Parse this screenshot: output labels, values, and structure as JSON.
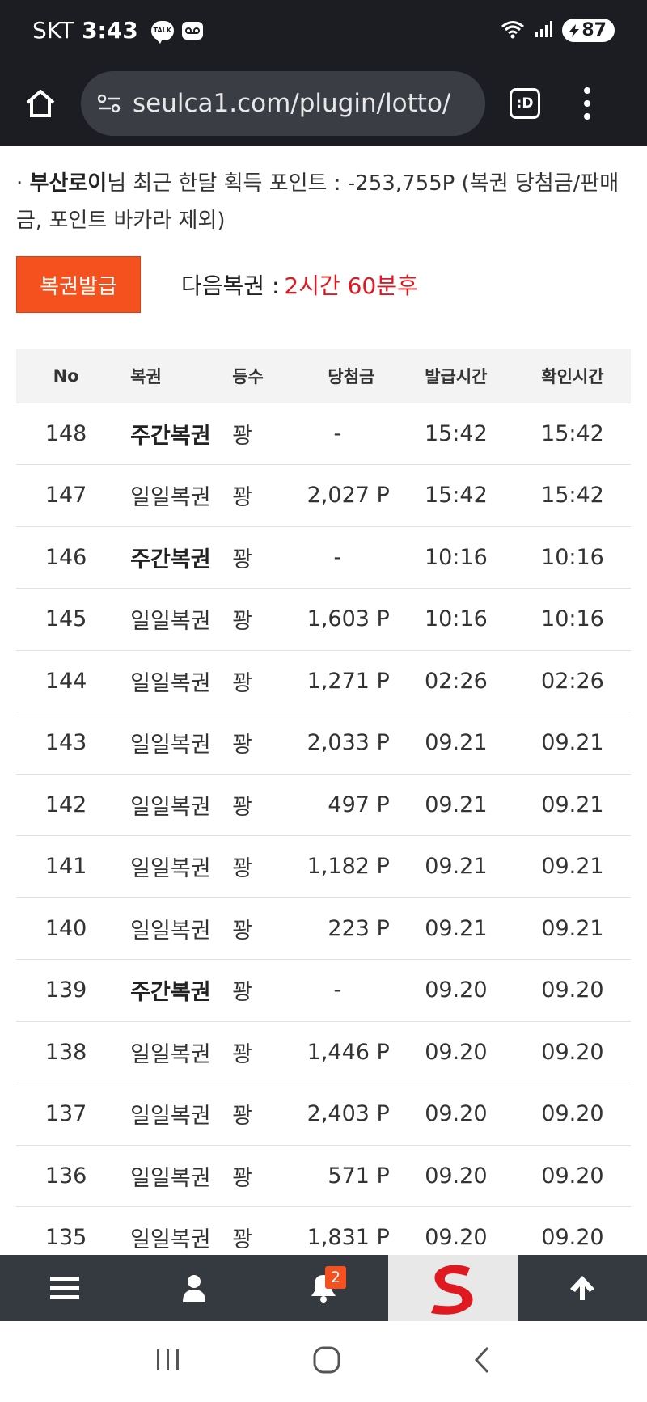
{
  "status": {
    "carrier": "SKT",
    "time": "3:43",
    "talk_label": "TALK",
    "battery": "87"
  },
  "browser": {
    "url": "seulca1.com/plugin/lotto/",
    "tabs_label": ":D"
  },
  "points": {
    "prefix": "· ",
    "username": "부산로이",
    "text": "님 최근 한달 획득 포인트 : -253,755P (복권 당첨금/판매금, 포인트 바카라 제외)"
  },
  "issue": {
    "button_label": "복권발급",
    "next_label": "다음복권 :",
    "next_value": "2시간 60분후"
  },
  "table": {
    "headers": {
      "no": "No",
      "type": "복권",
      "rank": "등수",
      "prize": "당첨금",
      "issued": "발급시간",
      "checked": "확인시간"
    },
    "rows": [
      {
        "no": "148",
        "type": "주간복권",
        "rank": "꽝",
        "prize": "-",
        "issued": "15:42",
        "checked": "15:42"
      },
      {
        "no": "147",
        "type": "일일복권",
        "rank": "꽝",
        "prize": "2,027 P",
        "issued": "15:42",
        "checked": "15:42"
      },
      {
        "no": "146",
        "type": "주간복권",
        "rank": "꽝",
        "prize": "-",
        "issued": "10:16",
        "checked": "10:16"
      },
      {
        "no": "145",
        "type": "일일복권",
        "rank": "꽝",
        "prize": "1,603 P",
        "issued": "10:16",
        "checked": "10:16"
      },
      {
        "no": "144",
        "type": "일일복권",
        "rank": "꽝",
        "prize": "1,271 P",
        "issued": "02:26",
        "checked": "02:26"
      },
      {
        "no": "143",
        "type": "일일복권",
        "rank": "꽝",
        "prize": "2,033 P",
        "issued": "09.21",
        "checked": "09.21"
      },
      {
        "no": "142",
        "type": "일일복권",
        "rank": "꽝",
        "prize": "497 P",
        "issued": "09.21",
        "checked": "09.21"
      },
      {
        "no": "141",
        "type": "일일복권",
        "rank": "꽝",
        "prize": "1,182 P",
        "issued": "09.21",
        "checked": "09.21"
      },
      {
        "no": "140",
        "type": "일일복권",
        "rank": "꽝",
        "prize": "223 P",
        "issued": "09.21",
        "checked": "09.21"
      },
      {
        "no": "139",
        "type": "주간복권",
        "rank": "꽝",
        "prize": "-",
        "issued": "09.20",
        "checked": "09.20"
      },
      {
        "no": "138",
        "type": "일일복권",
        "rank": "꽝",
        "prize": "1,446 P",
        "issued": "09.20",
        "checked": "09.20"
      },
      {
        "no": "137",
        "type": "일일복권",
        "rank": "꽝",
        "prize": "2,403 P",
        "issued": "09.20",
        "checked": "09.20"
      },
      {
        "no": "136",
        "type": "일일복권",
        "rank": "꽝",
        "prize": "571 P",
        "issued": "09.20",
        "checked": "09.20"
      },
      {
        "no": "135",
        "type": "일일복권",
        "rank": "꽝",
        "prize": "1,831 P",
        "issued": "09.20",
        "checked": "09.20"
      }
    ]
  },
  "bottom_nav": {
    "items": [
      "menu-icon",
      "user-icon",
      "bell-icon",
      "site-logo",
      "arrow-up-icon"
    ],
    "notification_count": "2"
  },
  "colors": {
    "accent": "#f4511e",
    "next_value": "#e0181f",
    "top_bar": "#1b1d22",
    "bottom_nav": "#343a40"
  }
}
